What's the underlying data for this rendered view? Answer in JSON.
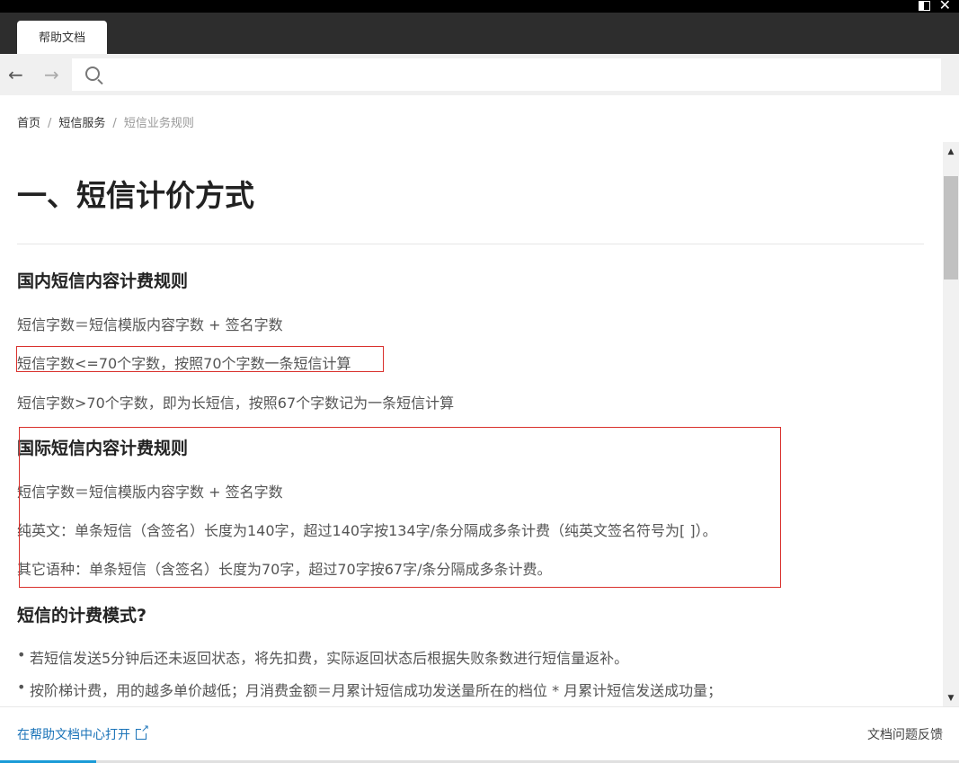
{
  "tab": {
    "label": "帮助文档"
  },
  "search": {
    "placeholder": ""
  },
  "breadcrumb": {
    "items": [
      "首页",
      "短信服务",
      "短信业务规则"
    ],
    "separator": "/"
  },
  "article": {
    "title": "一、短信计价方式",
    "sections": [
      {
        "heading": "国内短信内容计费规则",
        "paragraphs": [
          "短信字数＝短信模版内容字数 + 签名字数",
          "短信字数<=70个字数，按照70个字数一条短信计算",
          "短信字数>70个字数，即为长短信，按照67个字数记为一条短信计算"
        ]
      },
      {
        "heading": "国际短信内容计费规则",
        "paragraphs": [
          "短信字数＝短信模版内容字数 + 签名字数",
          "纯英文：单条短信（含签名）长度为140字，超过140字按134字/条分隔成多条计费（纯英文签名符号为[ ]）。",
          "其它语种：单条短信（含签名）长度为70字，超过70字按67字/条分隔成多条计费。"
        ]
      },
      {
        "heading": "短信的计费模式?",
        "bullets": [
          "若短信发送5分钟后还未返回状态，将先扣费，实际返回状态后根据失败条数进行短信量返补。",
          "按阶梯计费，用的越多单价越低；月消费金额＝月累计短信成功发送量所在的档位 * 月累计短信发送成功量；"
        ]
      }
    ]
  },
  "footer": {
    "open_link": "在帮助文档中心打开",
    "feedback": "文档问题反馈"
  },
  "progress": {
    "fraction": 0.1
  },
  "colors": {
    "highlight_box": "#d9302c",
    "link": "#1a73b8",
    "progress": "#1a9bd7"
  },
  "icons": [
    "restore-icon",
    "close-icon",
    "back-arrow-icon",
    "forward-arrow-icon",
    "search-icon",
    "external-link-icon",
    "scroll-up-icon",
    "scroll-down-icon"
  ]
}
